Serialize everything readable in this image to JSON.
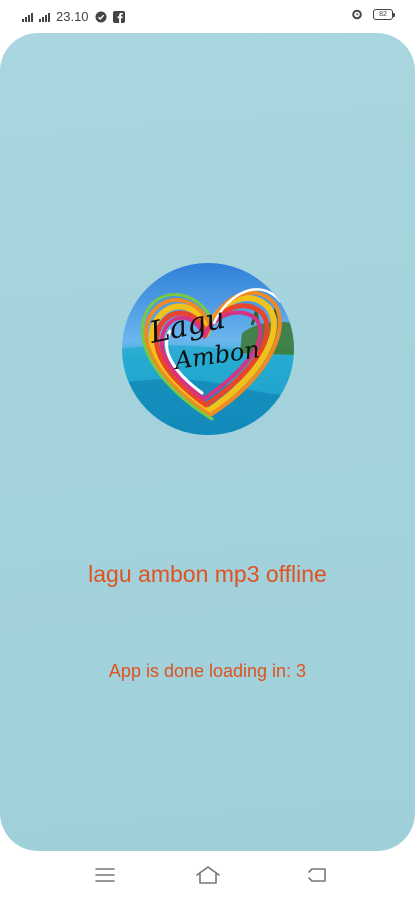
{
  "status_bar": {
    "time": "23.10",
    "battery": "82"
  },
  "splash": {
    "logo_text_line1": "Lagu",
    "logo_text_line2": "Ambon",
    "app_title": "lagu ambon mp3 offline",
    "loading_text": "App is done loading in: 3"
  },
  "nav": {
    "menu": "menu-icon",
    "home": "home-icon",
    "back": "back-icon"
  },
  "colors": {
    "background": "#a6d4dd",
    "accent_text": "#e0521f"
  }
}
